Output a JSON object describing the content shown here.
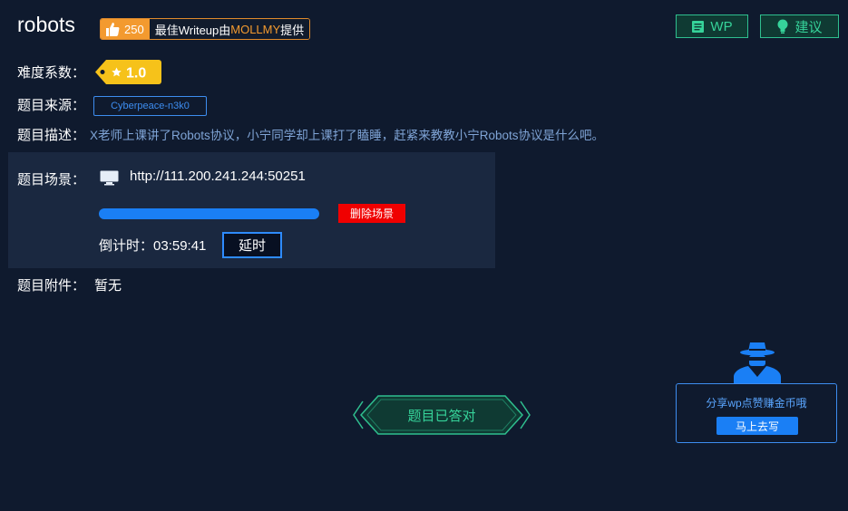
{
  "title": "robots",
  "writeup": {
    "likes": "250",
    "prefix": "最佳Writeup由",
    "author": "MOLLMY",
    "suffix": "提供"
  },
  "top_buttons": {
    "wp_label": "WP",
    "suggest_label": "建议"
  },
  "difficulty": {
    "label": "难度系数：",
    "value": "1.0"
  },
  "source": {
    "label": "题目来源：",
    "value": "Cyberpeace-n3k0"
  },
  "description": {
    "label": "题目描述：",
    "text": "X老师上课讲了Robots协议，小宁同学却上课打了瞌睡，赶紧来教教小宁Robots协议是什么吧。"
  },
  "scene": {
    "label": "题目场景：",
    "url": "http://111.200.241.244:50251",
    "progress": 1.0,
    "delete_label": "删除场景",
    "countdown_label": "倒计时：",
    "countdown": "03:59:41",
    "delay_label": "延时"
  },
  "attachment": {
    "label": "题目附件：",
    "value": "暂无"
  },
  "status_button": "题目已答对",
  "share": {
    "text": "分享wp点赞赚金币哦",
    "button": "马上去写"
  },
  "colors": {
    "background": "#0f1a2e",
    "accent_green": "#36d39a",
    "accent_blue": "#1a7ff5",
    "danger": "#f00000",
    "badge_yellow": "#f6c21a",
    "like_orange": "#f39a2f"
  }
}
